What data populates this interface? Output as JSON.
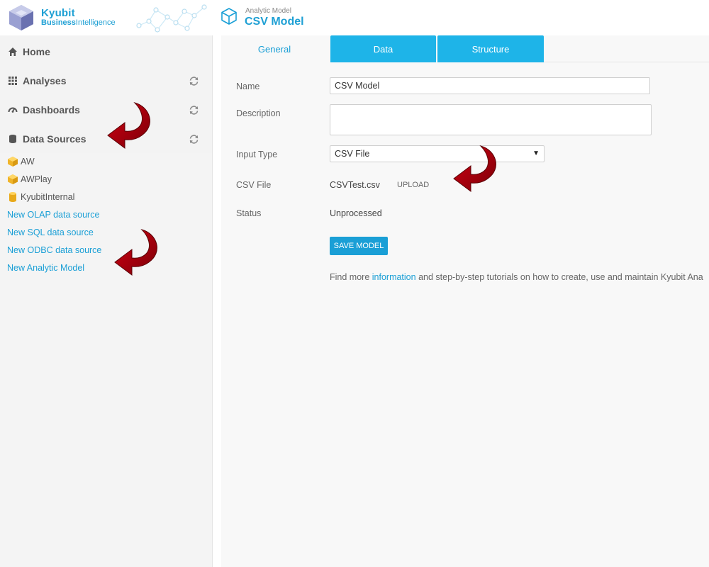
{
  "header": {
    "brand_name": "Kyubit",
    "brand_sub_bold": "Business",
    "brand_sub_light": "Intelligence",
    "model_kind": "Analytic Model",
    "model_name": "CSV Model"
  },
  "sidebar": {
    "nav": [
      {
        "label": "Home",
        "icon": "home-icon"
      },
      {
        "label": "Analyses",
        "icon": "grid-icon"
      },
      {
        "label": "Dashboards",
        "icon": "gauge-icon"
      },
      {
        "label": "Data Sources",
        "icon": "database-icon"
      }
    ],
    "data_sources": [
      {
        "label": "AW",
        "icon": "cube-icon"
      },
      {
        "label": "AWPlay",
        "icon": "cube-icon"
      },
      {
        "label": "KyubitInternal",
        "icon": "cylinder-icon"
      }
    ],
    "links": [
      "New OLAP data source",
      "New SQL data source",
      "New ODBC data source",
      "New Analytic Model"
    ]
  },
  "tabs": [
    {
      "label": "General",
      "active": true
    },
    {
      "label": "Data",
      "active": false
    },
    {
      "label": "Structure",
      "active": false
    }
  ],
  "form": {
    "name_label": "Name",
    "name_value": "CSV Model",
    "description_label": "Description",
    "description_value": "",
    "input_type_label": "Input Type",
    "input_type_value": "CSV File",
    "csv_file_label": "CSV File",
    "csv_file_value": "CSVTest.csv",
    "upload_label": "UPLOAD",
    "status_label": "Status",
    "status_value": "Unprocessed",
    "save_label": "SAVE MODEL"
  },
  "info": {
    "prefix": "Find more ",
    "link": "information",
    "suffix": " and step-by-step tutorials on how to create, use and maintain Kyubit Ana"
  },
  "colors": {
    "accent": "#1a9fd6",
    "tab_inactive": "#1eb4e8",
    "arrow": "#a8000a"
  }
}
